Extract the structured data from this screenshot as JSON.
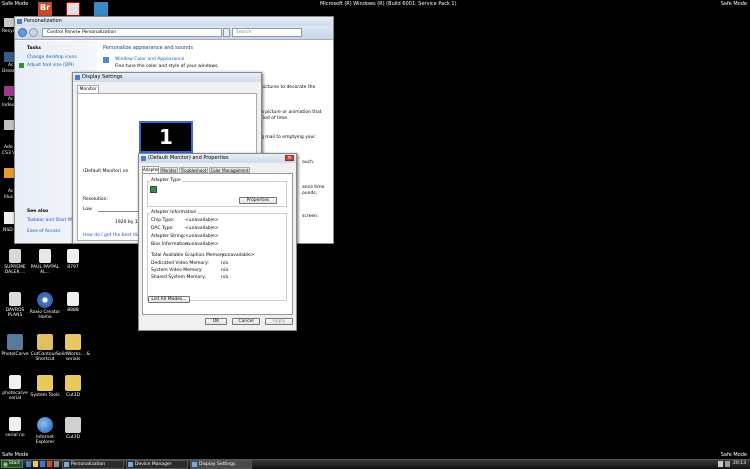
{
  "desktop": {
    "safe_mode_tl": "Safe Mode",
    "safe_mode_tr": "Safe Mode",
    "safe_mode_bl": "Safe Mode",
    "safe_mode_br": "Safe Mode",
    "build_string": "Microsoft (R) Windows (R) (Build 6001: Service Pack 1)",
    "left_cut_labels": [
      "Recyc",
      "Ac",
      "Dream",
      "Ac",
      "Indes",
      "Ado",
      "CS3 V",
      "Ac",
      "Illus",
      "NSD"
    ],
    "icons": [
      {
        "label": "SUPREME DALEK ...",
        "color": "#d8d8d8"
      },
      {
        "label": "PAUL PAYPAL AL...",
        "color": "#e8e8e8"
      },
      {
        "label": "8797",
        "color": "#f0f0f0"
      },
      {
        "label": "DAVROS PLANS",
        "color": "#dcdcdc"
      },
      {
        "label": "Roxio Creator Home",
        "color": "#4a78c8"
      },
      {
        "label": "8888",
        "color": "#f0f0f0"
      },
      {
        "label": "PhotoICarve",
        "color": "#5a7a9a"
      },
      {
        "label": "CutContour - Shortcut",
        "color": "#e0c060"
      },
      {
        "label": "SolidWorks... & serials",
        "color": "#e8c860"
      },
      {
        "label": "photocarve serial",
        "color": "#f0f0f0"
      },
      {
        "label": "System Tools",
        "color": "#e8c860"
      },
      {
        "label": "Cut3D",
        "color": "#e8c860"
      },
      {
        "label": "serial no",
        "color": "#f0f0f0"
      },
      {
        "label": "Internet Explorer",
        "color": "#3a7ad0"
      },
      {
        "label": "Cut3D",
        "color": "#d0d0d0"
      }
    ],
    "top_icons_colors": [
      "#c84a2a",
      "#b84a20",
      "#e0e0e0",
      "#3a8ac8"
    ]
  },
  "personalization": {
    "title": "Personalization",
    "breadcrumb": "Control Panel ▸ Personalization",
    "search_placeholder": "Search",
    "tasks_heading": "Tasks",
    "tasks": [
      "Change desktop icons",
      "Adjust font size (DPI)"
    ],
    "see_also_heading": "See also",
    "see_also": [
      "Taskbar and Start Menu",
      "Ease of Access"
    ],
    "main_heading": "Personalize appearance and sounds",
    "window_color_link": "Window Color and Appearance",
    "window_color_desc": "Fine tune the color and style of your windows.",
    "right_fragments": [
      "pictures to decorate the",
      "a picture or animation that",
      "riod of time.",
      "g mail to emptying your",
      "ouch.",
      "ance time",
      "ounds,",
      "screen."
    ]
  },
  "display_settings": {
    "title": "Display Settings",
    "tab": "Monitor",
    "monitor_number": "1",
    "monitor_label": "(Default Monitor) on",
    "resolution_label": "Resolution:",
    "resolution_low": "Low",
    "resolution_value": "1920 by 12",
    "help_link": "How do I get the best dis"
  },
  "properties": {
    "title": "(Default Monitor) and Properties",
    "tabs": [
      "Adapter",
      "Monitor",
      "Troubleshoot",
      "Color Management"
    ],
    "adapter_type_label": "Adapter Type",
    "properties_button": "Properties",
    "adapter_info_label": "Adapter Information",
    "info_rows": [
      {
        "k": "Chip Type:",
        "v": "<unavailable>"
      },
      {
        "k": "DAC Type:",
        "v": "<unavailable>"
      },
      {
        "k": "Adapter String:",
        "v": "<unavailable>"
      },
      {
        "k": "Bios Information:",
        "v": "<unavailable>"
      }
    ],
    "memory_rows": [
      {
        "k": "Total Available Graphics Memory:",
        "v": "<unavailable>"
      },
      {
        "k": "Dedicated Video Memory:",
        "v": "n/a"
      },
      {
        "k": "System Video Memory:",
        "v": "n/a"
      },
      {
        "k": "Shared System Memory:",
        "v": "n/a"
      }
    ],
    "list_modes_button": "List All Modes...",
    "ok": "OK",
    "cancel": "Cancel",
    "apply": "Apply"
  },
  "taskbar": {
    "start": "Start",
    "tasks": [
      "Personalization",
      "Device Manager",
      "Display Settings"
    ],
    "clock": "20:13"
  }
}
